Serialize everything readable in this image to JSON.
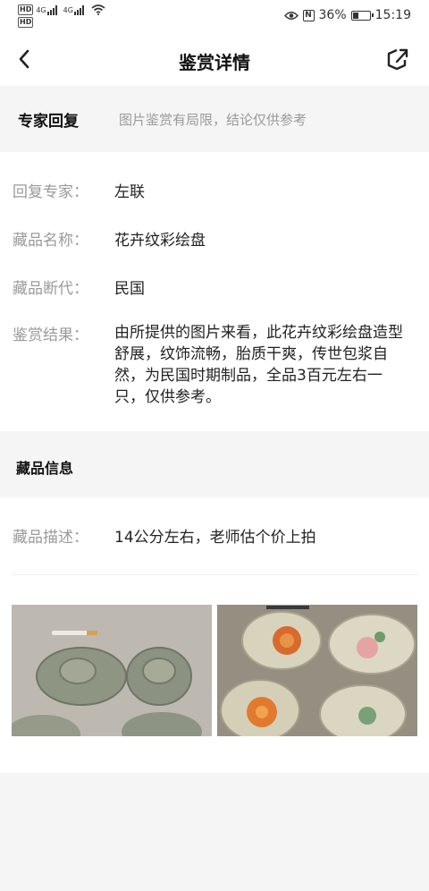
{
  "status_bar": {
    "sim1_badge": "HD",
    "sim2_badge": "HD",
    "net1": "4G",
    "net2": "4G",
    "battery_percent": "36%",
    "battery_level": 0.36,
    "time": "15:19",
    "icons": [
      "eye-icon",
      "nfc-icon",
      "wifi-icon",
      "signal-icon",
      "battery-icon"
    ]
  },
  "nav": {
    "title": "鉴赏详情",
    "back_icon": "chevron-left-icon",
    "share_icon": "share-icon"
  },
  "expert_section": {
    "title": "专家回复",
    "note": "图片鉴赏有局限，结论仅供参考"
  },
  "info": {
    "expert_label": "回复专家：",
    "expert_value": "左联",
    "name_label": "藏品名称：",
    "name_value": "花卉纹彩绘盘",
    "era_label": "藏品断代：",
    "era_value": "民国",
    "result_label": "鉴赏结果：",
    "result_value": "由所提供的图片来看，此花卉纹彩绘盘造型舒展，纹饰流畅，胎质干爽，传世包浆自然，为民国时期制品，全品3百元左右一只，仅供参考。"
  },
  "collection_section": {
    "title": "藏品信息",
    "desc_label": "藏品描述：",
    "desc_value": "14公分左右，老师估个价上拍"
  },
  "colors": {
    "page_bg": "#f5f5f5",
    "card_bg": "#ffffff",
    "label_gray": "#9a9a9a",
    "text_dark": "#222222"
  }
}
